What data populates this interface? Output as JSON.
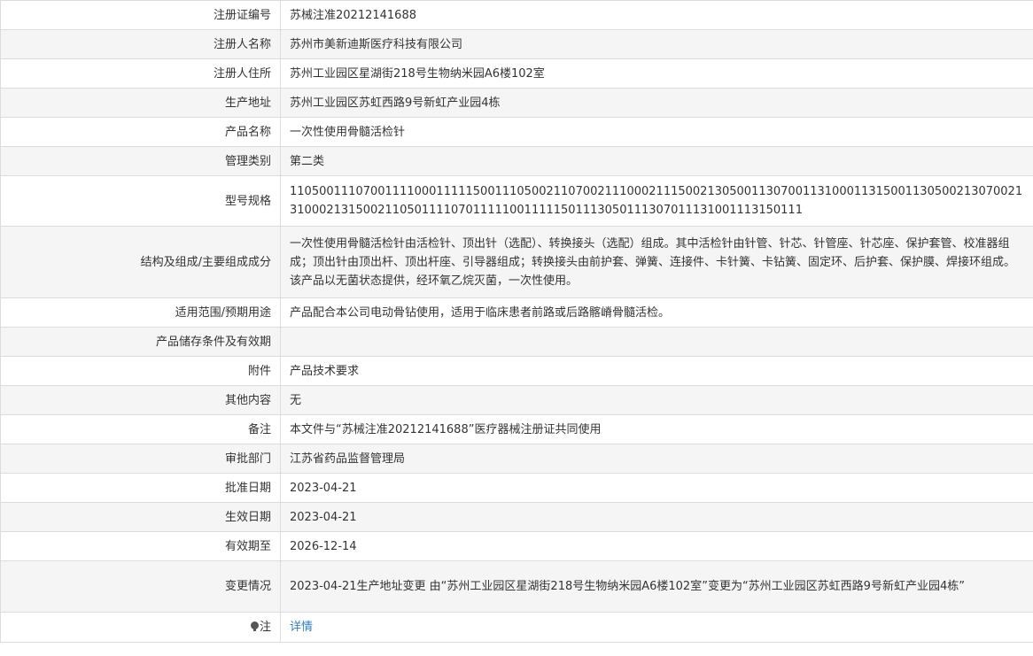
{
  "rows": [
    {
      "label": "注册证编号",
      "value": "苏械注准20212141688"
    },
    {
      "label": "注册人名称",
      "value": "苏州市美新迪斯医疗科技有限公司"
    },
    {
      "label": "注册人住所",
      "value": "苏州工业园区星湖街218号生物纳米园A6楼102室"
    },
    {
      "label": "生产地址",
      "value": "苏州工业园区苏虹西路9号新虹产业园4栋"
    },
    {
      "label": "产品名称",
      "value": "一次性使用骨髓活检针"
    },
    {
      "label": "管理类别",
      "value": "第二类"
    },
    {
      "label": "型号规格",
      "value": "11050011107001111000111115001110500211070021110002111500213050011307001131000113150011305002130700213100021315002110501111070111110011111501113050111307011131001113150111"
    },
    {
      "label": "结构及组成/主要组成成分",
      "value": "一次性使用骨髓活检针由活检针、顶出针（选配）、转换接头（选配）组成。其中活检针由针管、针芯、针管座、针芯座、保护套管、校准器组成；顶出针由顶出杆、顶出杆座、引导器组成；转换接头由前护套、弹簧、连接件、卡针簧、卡钻簧、固定环、后护套、保护膜、焊接环组成。该产品以无菌状态提供，经环氧乙烷灭菌，一次性使用。"
    },
    {
      "label": "适用范围/预期用途",
      "value": "产品配合本公司电动骨钻使用，适用于临床患者前路或后路髂嵴骨髓活检。"
    },
    {
      "label": "产品储存条件及有效期",
      "value": ""
    },
    {
      "label": "附件",
      "value": "产品技术要求"
    },
    {
      "label": "其他内容",
      "value": "无"
    },
    {
      "label": "备注",
      "value": "本文件与“苏械注准20212141688”医疗器械注册证共同使用"
    },
    {
      "label": "审批部门",
      "value": "江苏省药品监督管理局"
    },
    {
      "label": "批准日期",
      "value": "2023-04-21"
    },
    {
      "label": "生效日期",
      "value": "2023-04-21"
    },
    {
      "label": "有效期至",
      "value": "2026-12-14"
    },
    {
      "label": "变更情况",
      "value": "2023-04-21生产地址变更 由“苏州工业园区星湖街218号生物纳米园A6楼102室”变更为“苏州工业园区苏虹西路9号新虹产业园4栋”"
    }
  ],
  "note": {
    "icon": "lightbulb-icon",
    "label": "注",
    "link_text": "详情",
    "link_color": "#2f7fc8"
  }
}
